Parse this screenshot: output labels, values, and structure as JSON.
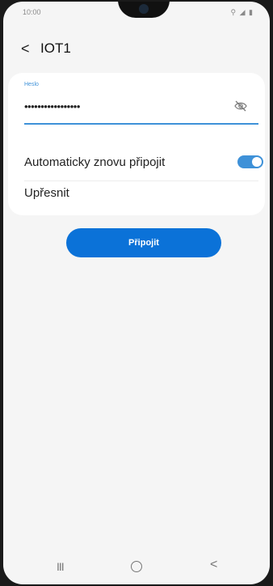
{
  "status_bar": {
    "time": "10:00",
    "icons": "⚲ ◢ ▮"
  },
  "header": {
    "back_glyph": "<",
    "title": "IOT1"
  },
  "password": {
    "label": "Heslo",
    "value": "•••••••••••••••••",
    "icon": "eye-slash-icon"
  },
  "settings": {
    "auto_reconnect_label": "Automaticky znovu připojit",
    "auto_reconnect_on": true,
    "advanced_label": "Upřesnit"
  },
  "connect_button": {
    "label": "Připojit"
  },
  "nav": {
    "recents_glyph": "III",
    "back_glyph": "<"
  },
  "colors": {
    "accent": "#3e91d8",
    "button": "#0b72d8",
    "background": "#f5f5f5"
  }
}
